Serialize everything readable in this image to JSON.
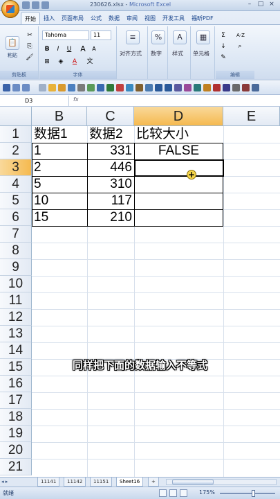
{
  "window": {
    "title": "230626.xlsx",
    "app": "Microsoft Excel",
    "minimize": "–",
    "maximize": "□",
    "close": "×"
  },
  "ribbon": {
    "tabs": [
      "开始",
      "插入",
      "页面布局",
      "公式",
      "数据",
      "审阅",
      "视图",
      "开发工具",
      "福昕PDF"
    ],
    "active_tab": "开始",
    "clipboard": {
      "paste_label": "粘贴",
      "group_label": "剪贴板"
    },
    "font": {
      "family": "Tahoma",
      "size": "11",
      "bold": "B",
      "italic": "I",
      "underline": "U",
      "font_color": "A",
      "grow": "A",
      "shrink": "A",
      "group_label": "字体"
    },
    "alignment": {
      "label": "对齐方式"
    },
    "number": {
      "label": "数字",
      "icon": "%"
    },
    "styles": {
      "label": "样式"
    },
    "cells": {
      "label": "单元格"
    },
    "editing": {
      "label": "编辑",
      "sum": "Σ",
      "sort": "A-Z"
    }
  },
  "formula_bar": {
    "name_box": "D3",
    "fx": "fx",
    "formula": ""
  },
  "grid": {
    "columns": [
      "B",
      "C",
      "D",
      "E"
    ],
    "selected_column": "D",
    "rows": [
      "1",
      "2",
      "3",
      "4",
      "5",
      "6",
      "7",
      "8",
      "9",
      "10",
      "11",
      "12",
      "13",
      "14",
      "15",
      "16",
      "17",
      "18",
      "19",
      "20",
      "21"
    ],
    "selected_row": "3",
    "cells": {
      "B1": "数据1",
      "C1": "数据2",
      "D1": "比较大小",
      "B2": "1",
      "C2": "331",
      "D2": "FALSE",
      "B3": "2",
      "C3": "446",
      "B4": "5",
      "C4": "310",
      "B5": "10",
      "C5": "117",
      "B6": "15",
      "C6": "210"
    }
  },
  "subtitle": "同样把下面的数据输入不等式",
  "sheets": {
    "nav": "◂ ▸",
    "tabs": [
      "11141",
      "11142",
      "11151",
      "Sheet16"
    ],
    "active": "Sheet16",
    "new_tab": "+"
  },
  "status": {
    "ready": "就绪",
    "zoom": "175%"
  }
}
